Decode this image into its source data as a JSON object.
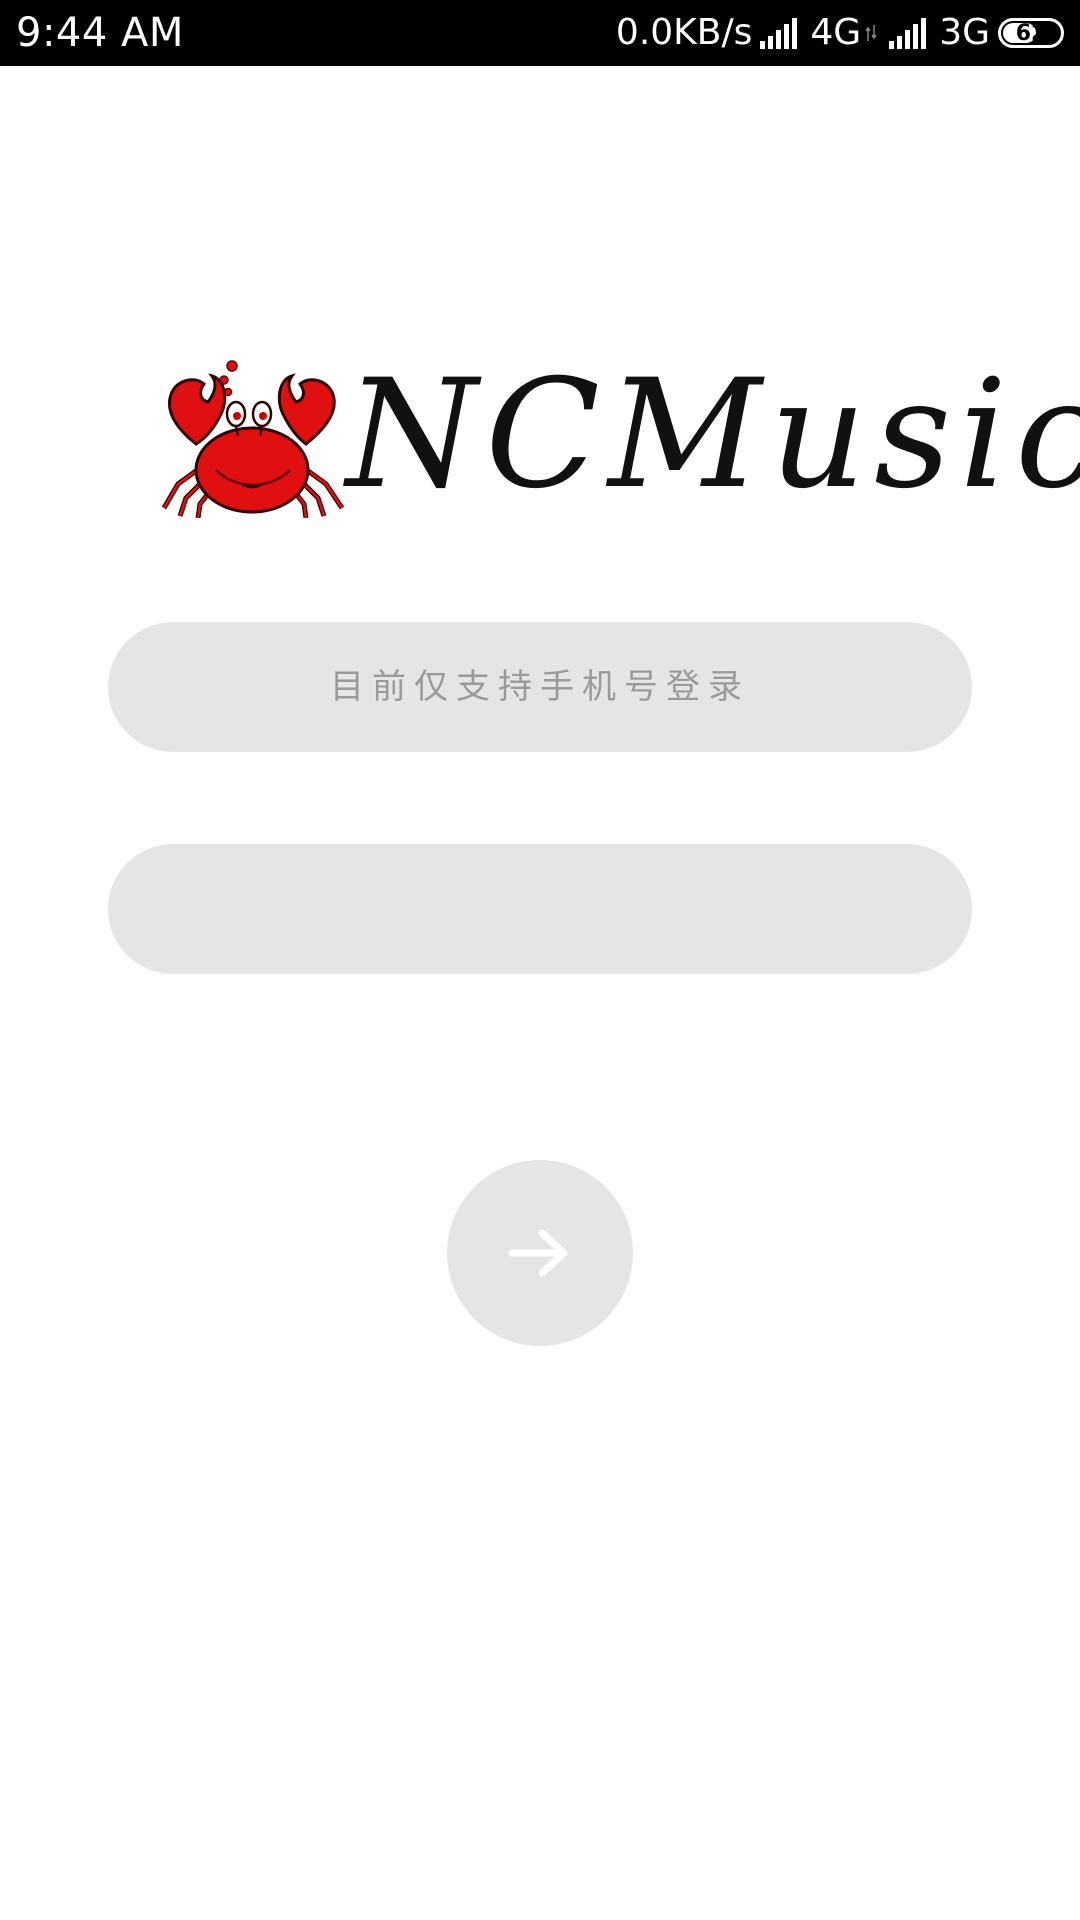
{
  "status_bar": {
    "time": "9:44  AM",
    "net_speed": "0.0KB/s",
    "network_1": "4G",
    "network_2": "3G",
    "battery_level": "62",
    "battery_fraction": 0.62
  },
  "logo": {
    "icon": "crab-icon",
    "text": "NCMusic",
    "accent_color": "#e01010"
  },
  "login_form": {
    "phone_placeholder": "目前仅支持手机号登录",
    "phone_value": "",
    "password_placeholder": "",
    "password_value": "",
    "submit_icon": "arrow-right-icon"
  },
  "colors": {
    "field_background": "#e5e5e5",
    "status_bar_background": "#000000",
    "page_background": "#ffffff"
  }
}
